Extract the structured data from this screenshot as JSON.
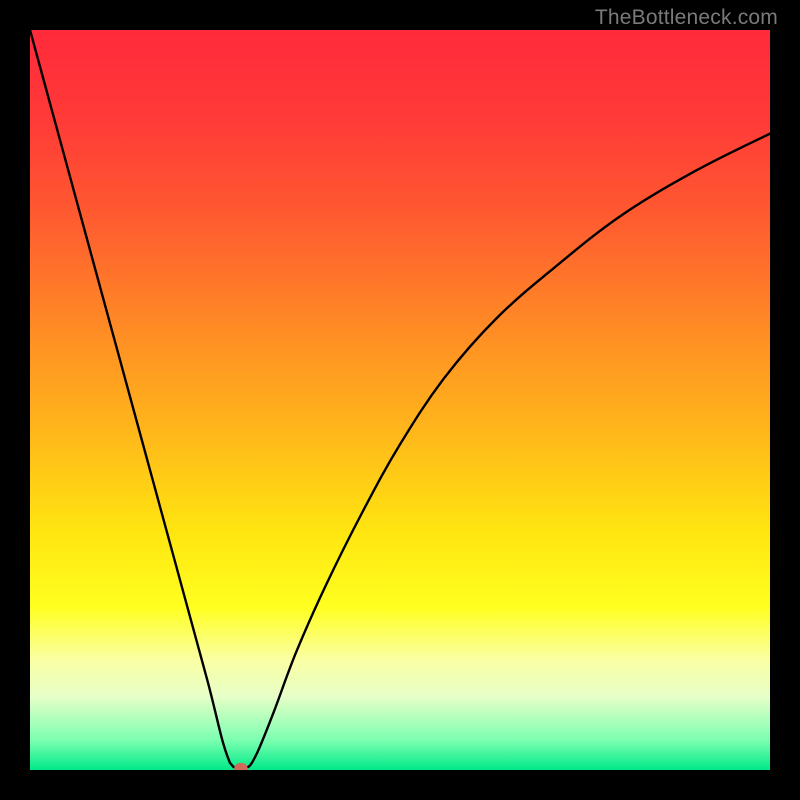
{
  "watermark": "TheBottleneck.com",
  "chart_data": {
    "type": "line",
    "title": "",
    "xlabel": "",
    "ylabel": "",
    "xlim": [
      0,
      100
    ],
    "ylim": [
      0,
      100
    ],
    "grid": false,
    "legend": false,
    "background": {
      "type": "vertical-gradient",
      "stops": [
        {
          "pct": 0,
          "color": "#ff2a3b"
        },
        {
          "pct": 12,
          "color": "#ff3a38"
        },
        {
          "pct": 25,
          "color": "#ff5a30"
        },
        {
          "pct": 40,
          "color": "#ff8a25"
        },
        {
          "pct": 55,
          "color": "#ffb91a"
        },
        {
          "pct": 68,
          "color": "#ffe610"
        },
        {
          "pct": 78,
          "color": "#ffff20"
        },
        {
          "pct": 85,
          "color": "#faffa2"
        },
        {
          "pct": 90,
          "color": "#e8ffc8"
        },
        {
          "pct": 96,
          "color": "#7bffb0"
        },
        {
          "pct": 100,
          "color": "#00e989"
        }
      ]
    },
    "series": [
      {
        "name": "bottleneck-curve",
        "color": "#000000",
        "x": [
          0,
          3,
          6,
          9,
          12,
          15,
          18,
          21,
          24,
          26,
          27,
          28,
          29,
          30,
          31,
          33,
          36,
          40,
          45,
          50,
          56,
          63,
          71,
          80,
          90,
          100
        ],
        "y": [
          100,
          89,
          78,
          67,
          56,
          45,
          34,
          23,
          12,
          4,
          1,
          0,
          0,
          1,
          3,
          8,
          16,
          25,
          35,
          44,
          53,
          61,
          68,
          75,
          81,
          86
        ]
      }
    ],
    "marker": {
      "name": "minimum-marker",
      "x": 28.5,
      "y": 0,
      "color": "#d06a5a",
      "rx": 0.9,
      "ry": 0.7
    },
    "plateau": {
      "x_start": 27.5,
      "x_end": 29.5,
      "y": 0.4
    }
  }
}
